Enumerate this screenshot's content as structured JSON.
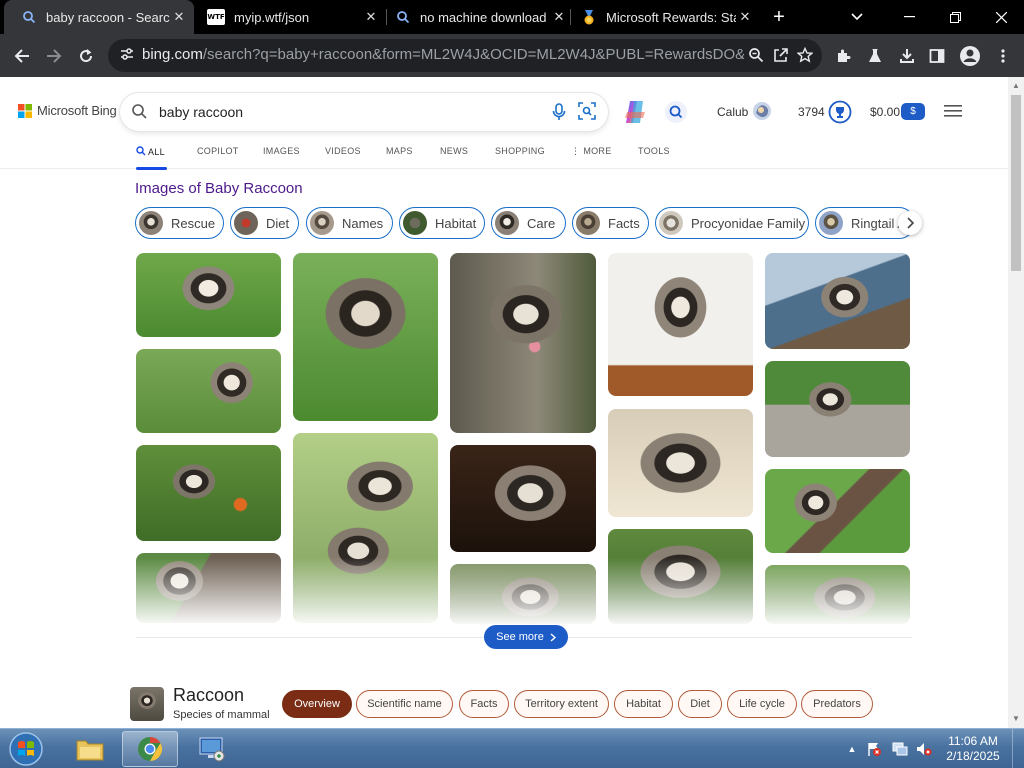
{
  "browser": {
    "tabs": [
      {
        "title": "baby raccoon - Search",
        "favicon": "search-icon",
        "active": true
      },
      {
        "title": "myip.wtf/json",
        "favicon": "wtf-icon",
        "favicon_text": "WTF",
        "active": false
      },
      {
        "title": "no machine download",
        "favicon": "search-icon",
        "active": false
      },
      {
        "title": "Microsoft Rewards: Sta",
        "favicon": "rewards-medal-icon",
        "active": false
      }
    ],
    "url_host": "bing.com",
    "url_rest": "/search?q=baby+raccoon&form=ML2W4J&OCID=ML2W4J&PUBL=RewardsDO&CRE..."
  },
  "bing": {
    "logo_text": "Microsoft Bing",
    "query": "baby raccoon",
    "user_name": "Calub",
    "points": "3794",
    "balance": "$0.00",
    "balance_badge": "$",
    "nav": [
      "ALL",
      "COPILOT",
      "IMAGES",
      "VIDEOS",
      "MAPS",
      "NEWS",
      "SHOPPING",
      "MORE",
      "TOOLS"
    ],
    "images_heading": "Images of Baby Raccoon",
    "chips": [
      "Rescue",
      "Diet",
      "Names",
      "Habitat",
      "Care",
      "Facts",
      "Procyonidae Family",
      "Ringtail A"
    ],
    "see_more": "See more",
    "entity": {
      "name": "Raccoon",
      "description": "Species of mammal",
      "tabs": [
        "Overview",
        "Scientific name",
        "Facts",
        "Territory extent",
        "Habitat",
        "Diet",
        "Life cycle",
        "Predators"
      ]
    }
  },
  "colors": {
    "accent_blue": "#174ae4",
    "heading_purple": "#4d1a8c",
    "entity_tab_active": "#7a2d14",
    "taskbar": "#4a72a0"
  },
  "taskbar": {
    "time": "11:06 AM",
    "date": "2/18/2025",
    "items": [
      "start-orb-icon",
      "file-explorer-icon",
      "chrome-icon",
      "network-app-icon"
    ]
  }
}
